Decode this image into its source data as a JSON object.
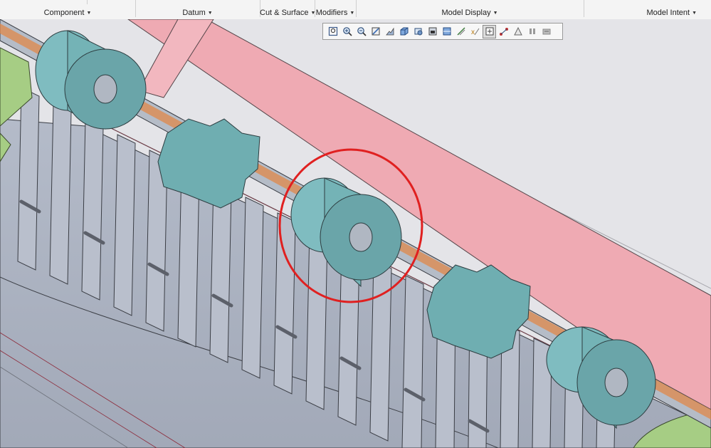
{
  "ribbon": {
    "groups": [
      {
        "label": "Component"
      },
      {
        "label": "Datum"
      },
      {
        "label": "Cut & Surface"
      },
      {
        "label": "Modifiers"
      },
      {
        "label": "Model Display"
      },
      {
        "label": "Model Intent"
      }
    ]
  },
  "view_toolbar": {
    "buttons": [
      {
        "icon": "refit-icon"
      },
      {
        "icon": "zoom-in-icon"
      },
      {
        "icon": "zoom-out-icon"
      },
      {
        "icon": "repaint-icon"
      },
      {
        "icon": "perspective-view-icon"
      },
      {
        "icon": "display-style-icon"
      },
      {
        "icon": "saved-orientations-icon"
      },
      {
        "icon": "view-manager-icon"
      },
      {
        "icon": "section-views-icon"
      },
      {
        "icon": "datum-display-filters-icon"
      },
      {
        "icon": "annotation-display-icon"
      },
      {
        "icon": "spin-center-icon",
        "active": true
      },
      {
        "icon": "appearance-icon"
      },
      {
        "icon": "model-display-icon"
      },
      {
        "icon": "pause-icon"
      },
      {
        "icon": "exit-icon"
      }
    ]
  },
  "colors": {
    "ribbon_bg": "#f4f4f4",
    "viewport_bg": "#e6e6ea",
    "shaft": "#b5bcc7",
    "bushing": "#74b3b6",
    "highlight_orange": "#e0884a",
    "frame_pink": "#f0aab2",
    "markup_circle": "#e02020",
    "green_part": "#a6cd84"
  }
}
